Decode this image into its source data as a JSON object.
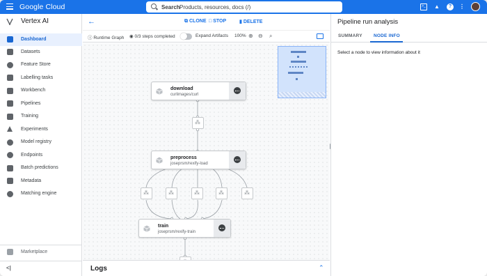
{
  "topbar": {
    "brand": "Google Cloud",
    "search_label": "Search",
    "search_placeholder": "Products, resources, docs (/)"
  },
  "sidebar": {
    "product": "Vertex AI",
    "items": [
      {
        "label": "Dashboard",
        "active": true
      },
      {
        "label": "Datasets"
      },
      {
        "label": "Feature Store"
      },
      {
        "label": "Labelling tasks"
      },
      {
        "label": "Workbench"
      },
      {
        "label": "Pipelines"
      },
      {
        "label": "Training"
      },
      {
        "label": "Experiments"
      },
      {
        "label": "Model registry"
      },
      {
        "label": "Endpoints"
      },
      {
        "label": "Batch predictions"
      },
      {
        "label": "Metadata"
      },
      {
        "label": "Matching engine"
      }
    ],
    "marketplace": "Marketplace",
    "collapse_label": "<|"
  },
  "actions": {
    "clone": "CLONE",
    "stop": "STOP",
    "delete": "DELETE"
  },
  "toolbar": {
    "runtime_graph": "Runtime Graph",
    "steps": "0/3 steps completed",
    "expand_artifacts": "Expand Artifacts",
    "zoom": "100%"
  },
  "graph": {
    "nodes": [
      {
        "title": "download",
        "subtitle": "curlimages/curl"
      },
      {
        "title": "preprocess",
        "subtitle": "joseprsm/rexify-load"
      },
      {
        "title": "train",
        "subtitle": "joseprsm/rexify-train"
      }
    ]
  },
  "logs": {
    "title": "Logs"
  },
  "panel": {
    "title": "Pipeline run analysis",
    "tabs": [
      "SUMMARY",
      "NODE INFO"
    ],
    "active_tab": "NODE INFO",
    "hint": "Select a node to view information about it"
  },
  "colors": {
    "accent": "#1a73e8",
    "active_bg": "#e8f0fe",
    "minimap": "#d2e3fc"
  }
}
